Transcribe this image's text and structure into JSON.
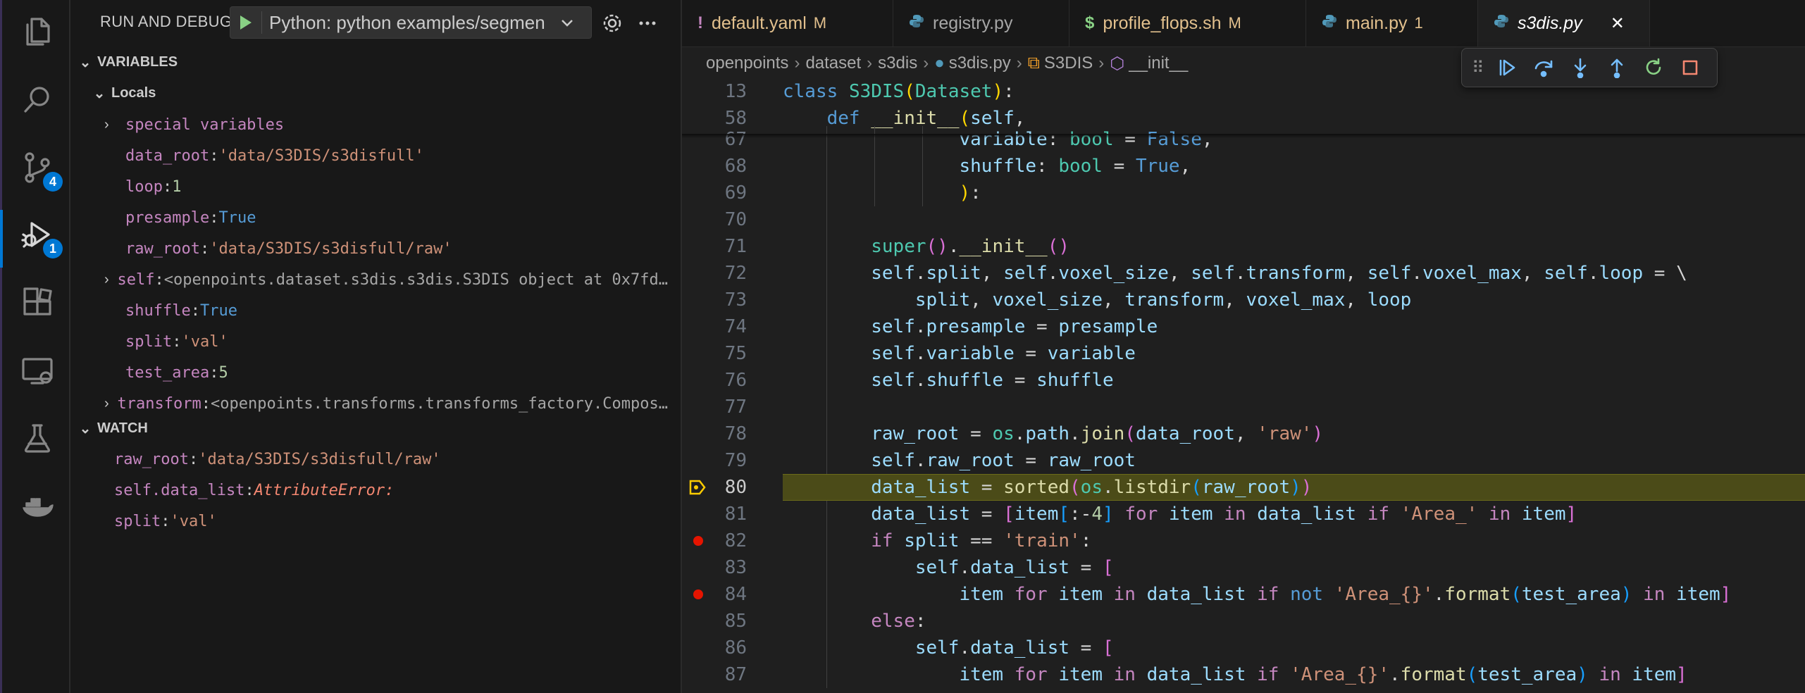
{
  "activity_bar": {
    "items": [
      {
        "icon": "files-icon"
      },
      {
        "icon": "search-icon"
      },
      {
        "icon": "source-control-icon",
        "badge": "4"
      },
      {
        "icon": "run-debug-icon",
        "badge": "1"
      },
      {
        "icon": "extensions-icon"
      },
      {
        "icon": "remote-explorer-icon"
      },
      {
        "icon": "testing-icon"
      },
      {
        "icon": "docker-icon"
      }
    ]
  },
  "sidebar": {
    "title": "RUN AND DEBUG",
    "launch_config": "Python: python examples/segmen",
    "variables_header": "VARIABLES",
    "locals_header": "Locals",
    "variables": [
      {
        "name": "special variables",
        "value": "",
        "expandable": true
      },
      {
        "name": "data_root",
        "value": "'data/S3DIS/s3disfull'",
        "kind": "str"
      },
      {
        "name": "loop",
        "value": "1",
        "kind": "num"
      },
      {
        "name": "presample",
        "value": "True",
        "kind": "bool"
      },
      {
        "name": "raw_root",
        "value": "'data/S3DIS/s3disfull/raw'",
        "kind": "str"
      },
      {
        "name": "self",
        "value": "<openpoints.dataset.s3dis.s3dis.S3DIS object at 0x7fd…",
        "kind": "obj",
        "expandable": true
      },
      {
        "name": "shuffle",
        "value": "True",
        "kind": "bool"
      },
      {
        "name": "split",
        "value": "'val'",
        "kind": "str"
      },
      {
        "name": "test_area",
        "value": "5",
        "kind": "num"
      },
      {
        "name": "transform",
        "value": "<openpoints.transforms.transforms_factory.Compos…",
        "kind": "obj",
        "expandable": true
      }
    ],
    "watch_header": "WATCH",
    "watch": [
      {
        "name": "raw_root",
        "value": "'data/S3DIS/s3disfull/raw'",
        "kind": "str"
      },
      {
        "name": "self.data_list",
        "value": "AttributeError:",
        "kind": "err"
      },
      {
        "name": "split",
        "value": "'val'",
        "kind": "str"
      }
    ]
  },
  "tabs": [
    {
      "label": "default.yaml",
      "icon": "!",
      "icon_color": "#c586c0",
      "status": "M",
      "color": "#e2c08d"
    },
    {
      "label": "registry.py",
      "icon": "py",
      "icon_color": "#519aba",
      "status": "",
      "color": "#a6a6a6"
    },
    {
      "label": "profile_flops.sh",
      "icon": "$",
      "icon_color": "#89d185",
      "status": "M",
      "color": "#e2c08d"
    },
    {
      "label": "main.py",
      "icon": "py",
      "icon_color": "#519aba",
      "status": "1",
      "color": "#e2c08d"
    },
    {
      "label": "s3dis.py",
      "icon": "py",
      "icon_color": "#519aba",
      "status": "",
      "color": "#ffffff",
      "active": true
    }
  ],
  "breadcrumb": [
    "openpoints",
    "dataset",
    "s3dis",
    "s3dis.py",
    "S3DIS",
    "__init__"
  ],
  "editor": {
    "sticky": [
      {
        "ln": "13",
        "html": "<span class='k'>class</span> <span class='cls'>S3DIS</span><span class='p1'>(</span><span class='cls'>Dataset</span><span class='p1'>)</span>:"
      },
      {
        "ln": "58",
        "html": "    <span class='k'>def</span> <span class='fn'>__init__</span><span class='p1'>(</span><span class='vr'>self</span>,"
      }
    ],
    "lines": [
      {
        "ln": "67",
        "html": "                <span class='vr'>variable</span>: <span class='cls'>bool</span> = <span class='k'>False</span>,"
      },
      {
        "ln": "68",
        "html": "                <span class='vr'>shuffle</span>: <span class='cls'>bool</span> = <span class='k'>True</span>,"
      },
      {
        "ln": "69",
        "html": "                <span class='p1'>)</span>:"
      },
      {
        "ln": "70",
        "html": ""
      },
      {
        "ln": "71",
        "html": "        <span class='cls'>super</span><span class='p2'>()</span>.<span class='fn'>__init__</span><span class='p2'>()</span>"
      },
      {
        "ln": "72",
        "html": "        <span class='vr'>self</span>.<span class='vr'>split</span>, <span class='vr'>self</span>.<span class='vr'>voxel_size</span>, <span class='vr'>self</span>.<span class='vr'>transform</span>, <span class='vr'>self</span>.<span class='vr'>voxel_max</span>, <span class='vr'>self</span>.<span class='vr'>loop</span> = \\"
      },
      {
        "ln": "73",
        "html": "            <span class='vr'>split</span>, <span class='vr'>voxel_size</span>, <span class='vr'>transform</span>, <span class='vr'>voxel_max</span>, <span class='vr'>loop</span>"
      },
      {
        "ln": "74",
        "html": "        <span class='vr'>self</span>.<span class='vr'>presample</span> = <span class='vr'>presample</span>"
      },
      {
        "ln": "75",
        "html": "        <span class='vr'>self</span>.<span class='vr'>variable</span> = <span class='vr'>variable</span>"
      },
      {
        "ln": "76",
        "html": "        <span class='vr'>self</span>.<span class='vr'>shuffle</span> = <span class='vr'>shuffle</span>"
      },
      {
        "ln": "77",
        "html": ""
      },
      {
        "ln": "78",
        "html": "        <span class='vr'>raw_root</span> = <span class='cls'>os</span>.<span class='vr'>path</span>.<span class='fn'>join</span><span class='p2'>(</span><span class='vr'>data_root</span>, <span class='st'>'raw'</span><span class='p2'>)</span>"
      },
      {
        "ln": "79",
        "html": "        <span class='vr'>self</span>.<span class='vr'>raw_root</span> = <span class='vr'>raw_root</span>"
      },
      {
        "ln": "80",
        "html": "        <span class='vr'>data_list</span> = <span class='fn'>sorted</span><span class='p2'>(</span><span class='cls'>os</span>.<span class='fn'>listdir</span><span class='p3'>(</span><span class='vr'>raw_root</span><span class='p3'>)</span><span class='p2'>)</span>",
        "current": true
      },
      {
        "ln": "81",
        "html": "        <span class='vr'>data_list</span> = <span class='p2'>[</span><span class='vr'>item</span><span class='p3'>[</span>:-<span class='nb'>4</span><span class='p3'>]</span> <span class='kc'>for</span> <span class='vr'>item</span> <span class='kc'>in</span> <span class='vr'>data_list</span> <span class='kc'>if</span> <span class='st'>'Area_'</span> <span class='kc'>in</span> <span class='vr'>item</span><span class='p2'>]</span>"
      },
      {
        "ln": "82",
        "html": "        <span class='kc'>if</span> <span class='vr'>split</span> == <span class='st'>'train'</span>:",
        "breakpoint": true
      },
      {
        "ln": "83",
        "html": "            <span class='vr'>self</span>.<span class='vr'>data_list</span> = <span class='p2'>[</span>"
      },
      {
        "ln": "84",
        "html": "                <span class='vr'>item</span> <span class='kc'>for</span> <span class='vr'>item</span> <span class='kc'>in</span> <span class='vr'>data_list</span> <span class='kc'>if</span> <span class='k'>not</span> <span class='st'>'Area_{}'</span>.<span class='fn'>format</span><span class='p3'>(</span><span class='vr'>test_area</span><span class='p3'>)</span> <span class='kc'>in</span> <span class='vr'>item</span><span class='p2'>]</span>",
        "breakpoint": true
      },
      {
        "ln": "85",
        "html": "        <span class='kc'>else</span>:"
      },
      {
        "ln": "86",
        "html": "            <span class='vr'>self</span>.<span class='vr'>data_list</span> = <span class='p2'>[</span>"
      },
      {
        "ln": "87",
        "html": "                <span class='vr'>item</span> <span class='kc'>for</span> <span class='vr'>item</span> <span class='kc'>in</span> <span class='vr'>data_list</span> <span class='kc'>if</span> <span class='st'>'Area_{}'</span>.<span class='fn'>format</span><span class='p3'>(</span><span class='vr'>test_area</span><span class='p3'>)</span> <span class='kc'>in</span> <span class='vr'>item</span><span class='p2'>]</span>"
      }
    ]
  },
  "debug_toolbar": [
    "continue-icon",
    "step-over-icon",
    "step-into-icon",
    "step-out-icon",
    "restart-icon",
    "stop-icon"
  ]
}
